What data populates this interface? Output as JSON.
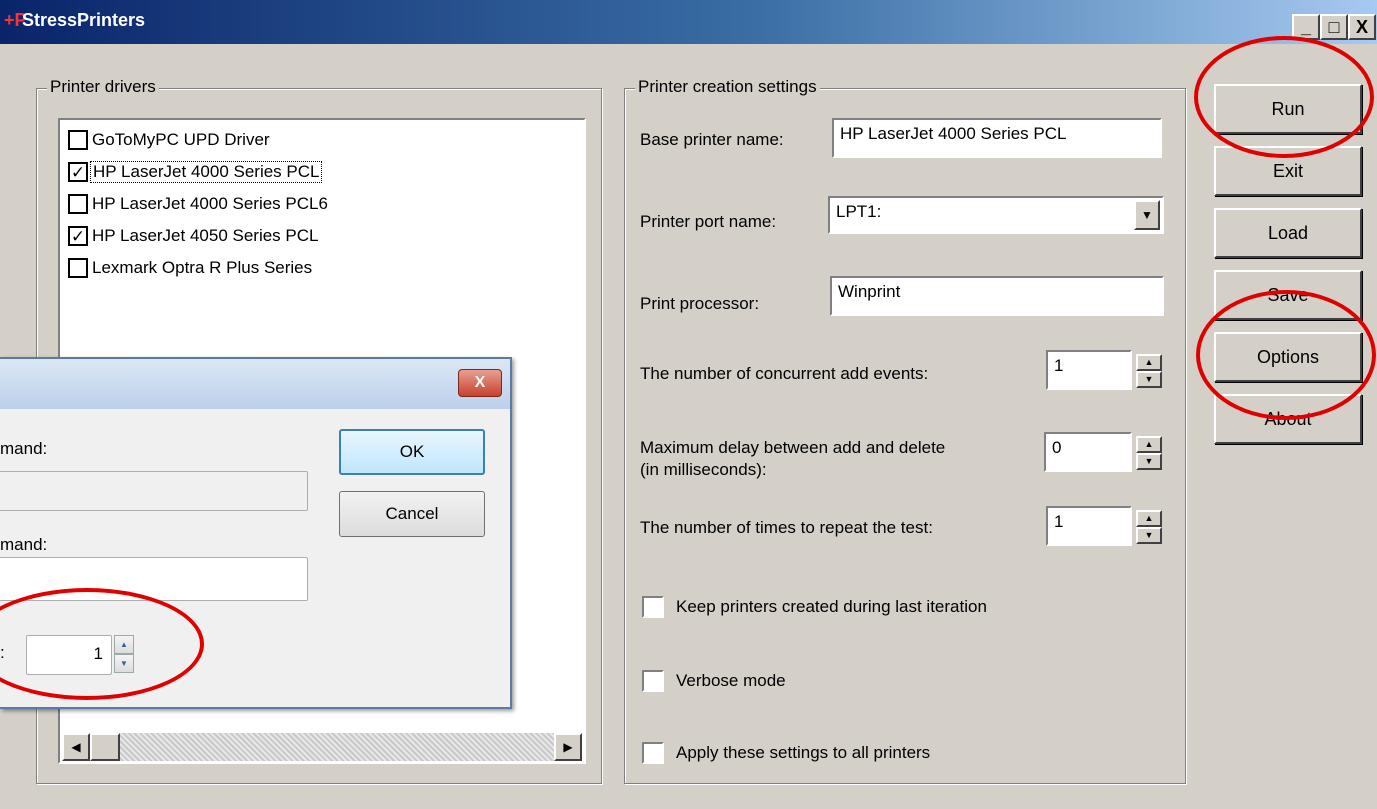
{
  "window": {
    "title": "StressPrinters",
    "title_icon": "+P",
    "controls": {
      "minimize": "_",
      "maximize": "□",
      "close": "X"
    }
  },
  "drivers": {
    "legend": "Printer drivers",
    "items": [
      {
        "label": "GoToMyPC UPD Driver",
        "checked": false,
        "mark": ""
      },
      {
        "label": "HP LaserJet 4000 Series PCL",
        "checked": true,
        "mark": "✓",
        "selected": true
      },
      {
        "label": "HP LaserJet 4000 Series PCL6",
        "checked": false,
        "mark": ""
      },
      {
        "label": "HP LaserJet 4050 Series PCL",
        "checked": true,
        "mark": "✓"
      },
      {
        "label": "Lexmark Optra R Plus Series",
        "checked": false,
        "mark": ""
      }
    ]
  },
  "settings": {
    "legend": "Printer creation settings",
    "base_name_label": "Base printer name:",
    "base_name_value": "HP LaserJet 4000 Series PCL",
    "port_label": "Printer port name:",
    "port_value": "LPT1:",
    "processor_label": "Print processor:",
    "processor_value": "Winprint",
    "concurrent_label": "The number of concurrent add events:",
    "concurrent_value": "1",
    "delay_label_1": "Maximum delay between add and delete",
    "delay_label_2": "(in milliseconds):",
    "delay_value": "0",
    "repeat_label": "The number of times to repeat the test:",
    "repeat_value": "1",
    "keep_label": "Keep printers created during last iteration",
    "verbose_label": "Verbose mode",
    "apply_label": "Apply these settings to all printers"
  },
  "buttons": {
    "run": "Run",
    "exit": "Exit",
    "load": "Load",
    "save": "Save",
    "options": "Options",
    "about": "About"
  },
  "dialog": {
    "close": "X",
    "label1": "mand:",
    "label2": "mand:",
    "label3": ":",
    "value3": "1",
    "ok": "OK",
    "cancel": "Cancel"
  },
  "colors": {
    "annotation": "#e00000",
    "titlebar": "#0a246a",
    "window_bg": "#d4d0c8"
  }
}
